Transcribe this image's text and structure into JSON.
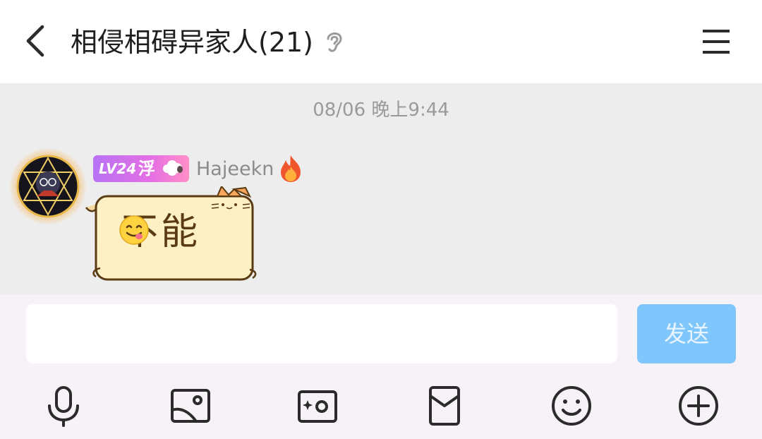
{
  "header": {
    "title": "相侵相碍异家人(21)",
    "back_icon": "chevron-left-icon",
    "ear_icon": "ear-icon",
    "menu_icon": "menu-icon"
  },
  "chat": {
    "timestamp": "08/06 晚上9:44",
    "message": {
      "badge_level": "LV24",
      "badge_title": "浮",
      "username": "Hajeekn",
      "text": "不能"
    }
  },
  "composer": {
    "input_value": "",
    "send_label": "发送"
  },
  "toolbar": [
    {
      "icon": "microphone-icon"
    },
    {
      "icon": "image-icon"
    },
    {
      "icon": "camera-icon"
    },
    {
      "icon": "red-packet-icon"
    },
    {
      "icon": "emoji-icon"
    },
    {
      "icon": "plus-circle-icon"
    }
  ],
  "colors": {
    "chat_background": "#ededed",
    "send_button": "#7ec6fc",
    "badge_gradient_start": "#b873f5",
    "badge_gradient_end": "#ff8fc7"
  }
}
